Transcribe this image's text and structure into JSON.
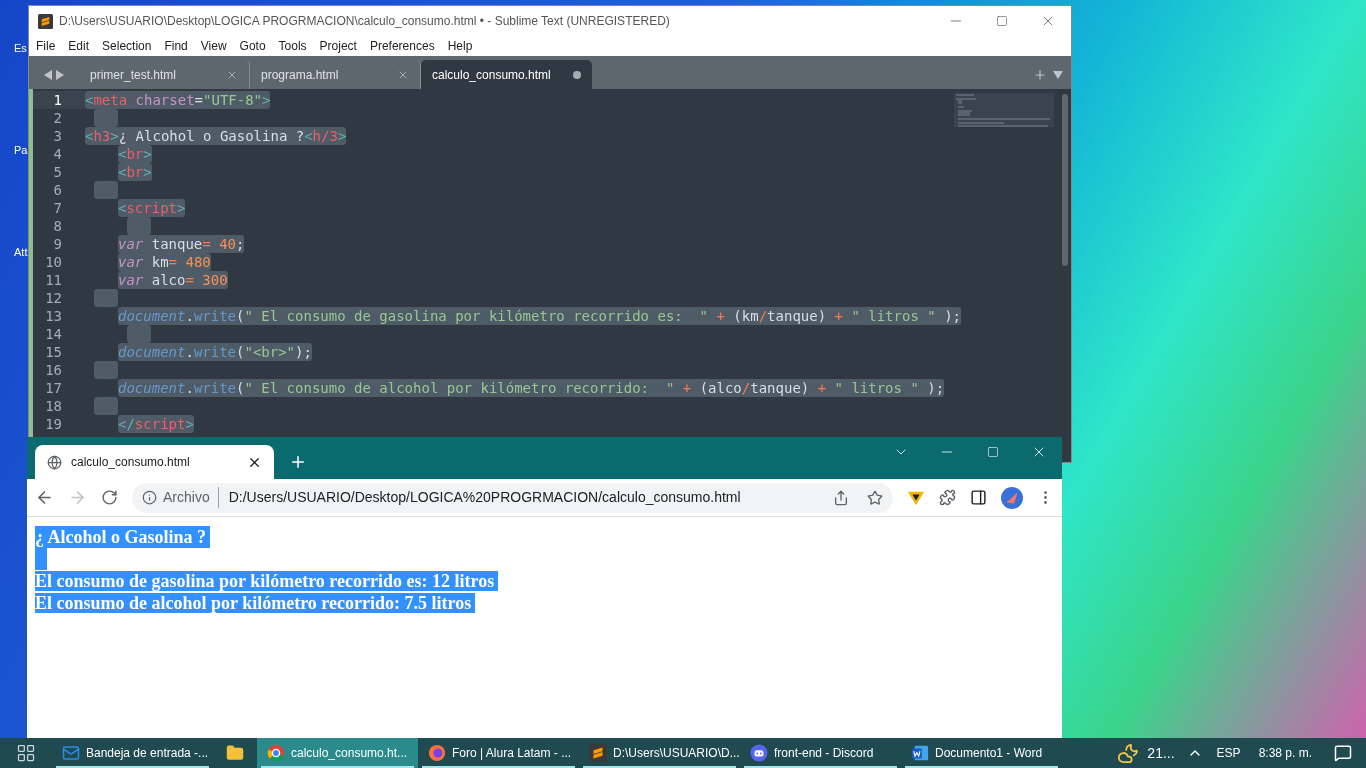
{
  "desktop_icons": [
    {
      "label": "Es"
    },
    {
      "label": "Pa"
    },
    {
      "label": "Att"
    }
  ],
  "sublime": {
    "title": "D:\\Users\\USUARIO\\Desktop\\LOGICA PROGRMACION\\calculo_consumo.html • - Sublime Text (UNREGISTERED)",
    "menu": [
      "File",
      "Edit",
      "Selection",
      "Find",
      "View",
      "Goto",
      "Tools",
      "Project",
      "Preferences",
      "Help"
    ],
    "tabs": [
      {
        "label": "primer_test.html",
        "selected": false,
        "unsaved": false
      },
      {
        "label": "programa.html",
        "selected": false,
        "unsaved": false
      },
      {
        "label": "calculo_consumo.html",
        "selected": true,
        "unsaved": true
      }
    ],
    "lines": [
      {
        "number": "1",
        "current": true,
        "indented": false,
        "tokens": [
          {
            "text": "<",
            "kind": "punct"
          },
          {
            "text": "meta",
            "kind": "tag"
          },
          {
            "text": " charset",
            "kind": "attr"
          },
          {
            "text": "=",
            "kind": "plain"
          },
          {
            "text": "\"UTF-8\"",
            "kind": "string"
          },
          {
            "text": ">",
            "kind": "punct"
          }
        ]
      },
      {
        "number": "2",
        "current": false,
        "indented": false
      },
      {
        "number": "3",
        "current": false,
        "indented": false,
        "tokens": [
          {
            "text": "<",
            "kind": "punct"
          },
          {
            "text": "h3",
            "kind": "tag"
          },
          {
            "text": ">",
            "kind": "punct"
          },
          {
            "text": "¿ Alcohol o Gasolina ?",
            "kind": "plain"
          },
          {
            "text": "<",
            "kind": "punct"
          },
          {
            "text": "h/3",
            "kind": "tag"
          },
          {
            "text": ">",
            "kind": "punct"
          }
        ]
      },
      {
        "number": "4",
        "current": false,
        "indented": true,
        "tokens": [
          {
            "text": "<",
            "kind": "punct"
          },
          {
            "text": "br",
            "kind": "tag"
          },
          {
            "text": ">",
            "kind": "punct"
          }
        ]
      },
      {
        "number": "5",
        "current": false,
        "indented": true,
        "tokens": [
          {
            "text": "<",
            "kind": "punct"
          },
          {
            "text": "br",
            "kind": "tag"
          },
          {
            "text": ">",
            "kind": "punct"
          }
        ]
      },
      {
        "number": "6",
        "current": false,
        "indented": false
      },
      {
        "number": "7",
        "current": false,
        "indented": true,
        "tokens": [
          {
            "text": "<",
            "kind": "punct"
          },
          {
            "text": "script",
            "kind": "tag"
          },
          {
            "text": ">",
            "kind": "punct"
          }
        ]
      },
      {
        "number": "8",
        "current": false,
        "indented": true
      },
      {
        "number": "9",
        "current": false,
        "indented": true,
        "tokens": [
          {
            "text": "var",
            "kind": "keyword"
          },
          {
            "text": " tanque",
            "kind": "plain"
          },
          {
            "text": "=",
            "kind": "op"
          },
          {
            "text": " 40",
            "kind": "number"
          },
          {
            "text": ";",
            "kind": "plain"
          }
        ]
      },
      {
        "number": "10",
        "current": false,
        "indented": true,
        "tokens": [
          {
            "text": "var",
            "kind": "keyword"
          },
          {
            "text": " km",
            "kind": "plain"
          },
          {
            "text": "=",
            "kind": "op"
          },
          {
            "text": " 480",
            "kind": "number"
          }
        ]
      },
      {
        "number": "11",
        "current": false,
        "indented": true,
        "tokens": [
          {
            "text": "var",
            "kind": "keyword"
          },
          {
            "text": " alco",
            "kind": "plain"
          },
          {
            "text": "=",
            "kind": "op"
          },
          {
            "text": " 300",
            "kind": "number"
          }
        ]
      },
      {
        "number": "12",
        "current": false,
        "indented": false
      },
      {
        "number": "13",
        "current": false,
        "indented": true,
        "tokens": [
          {
            "text": "document",
            "kind": "func"
          },
          {
            "text": ".",
            "kind": "plain"
          },
          {
            "text": "write",
            "kind": "method"
          },
          {
            "text": "(",
            "kind": "plain"
          },
          {
            "text": "\" El consumo de gasolina por kilómetro recorrido es:  \"",
            "kind": "string"
          },
          {
            "text": " + ",
            "kind": "op"
          },
          {
            "text": "(km",
            "kind": "plain"
          },
          {
            "text": "/",
            "kind": "op"
          },
          {
            "text": "tanque)",
            "kind": "plain"
          },
          {
            "text": " + ",
            "kind": "op"
          },
          {
            "text": "\" litros \"",
            "kind": "string"
          },
          {
            "text": " );",
            "kind": "plain"
          }
        ]
      },
      {
        "number": "14",
        "current": false,
        "indented": true
      },
      {
        "number": "15",
        "current": false,
        "indented": true,
        "tokens": [
          {
            "text": "document",
            "kind": "func"
          },
          {
            "text": ".",
            "kind": "plain"
          },
          {
            "text": "write",
            "kind": "method"
          },
          {
            "text": "(",
            "kind": "plain"
          },
          {
            "text": "\"<br>\"",
            "kind": "string"
          },
          {
            "text": ");",
            "kind": "plain"
          }
        ]
      },
      {
        "number": "16",
        "current": false,
        "indented": false
      },
      {
        "number": "17",
        "current": false,
        "indented": true,
        "tokens": [
          {
            "text": "document",
            "kind": "func"
          },
          {
            "text": ".",
            "kind": "plain"
          },
          {
            "text": "write",
            "kind": "method"
          },
          {
            "text": "(",
            "kind": "plain"
          },
          {
            "text": "\" El consumo de alcohol por kilómetro recorrido:  \"",
            "kind": "string"
          },
          {
            "text": " + ",
            "kind": "op"
          },
          {
            "text": "(alco",
            "kind": "plain"
          },
          {
            "text": "/",
            "kind": "op"
          },
          {
            "text": "tanque)",
            "kind": "plain"
          },
          {
            "text": " + ",
            "kind": "op"
          },
          {
            "text": "\" litros \"",
            "kind": "string"
          },
          {
            "text": " );",
            "kind": "plain"
          }
        ]
      },
      {
        "number": "18",
        "current": false,
        "indented": false
      },
      {
        "number": "19",
        "current": false,
        "indented": true,
        "tokens": [
          {
            "text": "</",
            "kind": "punct"
          },
          {
            "text": "script",
            "kind": "tag"
          },
          {
            "text": ">",
            "kind": "punct"
          }
        ]
      }
    ]
  },
  "browser": {
    "tab": {
      "label": "calculo_consumo.html",
      "selected": true
    },
    "address": {
      "scheme_label": "Archivo",
      "url": "D:/Users/USUARIO/Desktop/LOGICA%20PROGRMACION/calculo_consumo.html"
    },
    "page": {
      "heading": "¿ Alcohol o Gasolina ?",
      "lines": [
        "El consumo de gasolina por kilómetro recorrido es: 12 litros",
        "El consumo de alcohol por kilómetro recorrido: 7.5 litros"
      ]
    }
  },
  "taskbar": {
    "items": [
      {
        "kind": "mail",
        "label": "Bandeja de entrada -...",
        "selected": false,
        "running": true
      },
      {
        "kind": "folder",
        "selected": false,
        "running": false
      },
      {
        "kind": "chrome",
        "label": "calculo_consumo.ht...",
        "selected": true,
        "running": true
      },
      {
        "kind": "firefox",
        "label": "Foro | Alura Latam - ...",
        "selected": false,
        "running": true
      },
      {
        "kind": "sublime",
        "label": "D:\\Users\\USUARIO\\D...",
        "selected": false,
        "running": true
      },
      {
        "kind": "discord",
        "label": "front-end - Discord",
        "selected": false,
        "running": true
      },
      {
        "kind": "word",
        "label": "Documento1 - Word",
        "selected": false,
        "running": true
      }
    ],
    "weather": "21...",
    "language": "ESP",
    "time": "8:38 p. m."
  }
}
